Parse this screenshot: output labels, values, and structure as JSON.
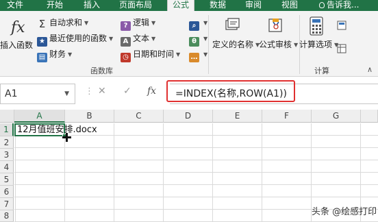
{
  "tabs": [
    "文件",
    "开始",
    "插入",
    "页面布局",
    "公式",
    "数据",
    "审阅",
    "视图",
    "告诉我..."
  ],
  "active_tab": "公式",
  "ribbon": {
    "insert_function": "插入函数",
    "autosum": "自动求和",
    "recently_used": "最近使用的函数",
    "financial": "财务",
    "logical": "逻辑",
    "text": "文本",
    "date_time": "日期和时间",
    "define_name": "定义的名称",
    "formula_auditing": "公式审核",
    "calc_options": "计算选项",
    "function_library_label": "函数库",
    "calculation_label": "计算"
  },
  "formula_bar": {
    "name_box": "A1",
    "cancel_symbol": "✕",
    "enter_symbol": "✓",
    "fx_symbol": "fx",
    "formula": "=INDEX(名称,ROW(A1))"
  },
  "sheet": {
    "columns": [
      "A",
      "B",
      "C",
      "D",
      "E",
      "F",
      "G"
    ],
    "rows": [
      "1",
      "2",
      "3",
      "4",
      "5",
      "6",
      "7",
      "8"
    ],
    "selected_cell": "A1",
    "cells": {
      "A1": "12月值班安排.docx"
    }
  },
  "watermark": "头条 @绘感打印",
  "colors": {
    "accent": "#217346",
    "highlight": "#e03030"
  }
}
